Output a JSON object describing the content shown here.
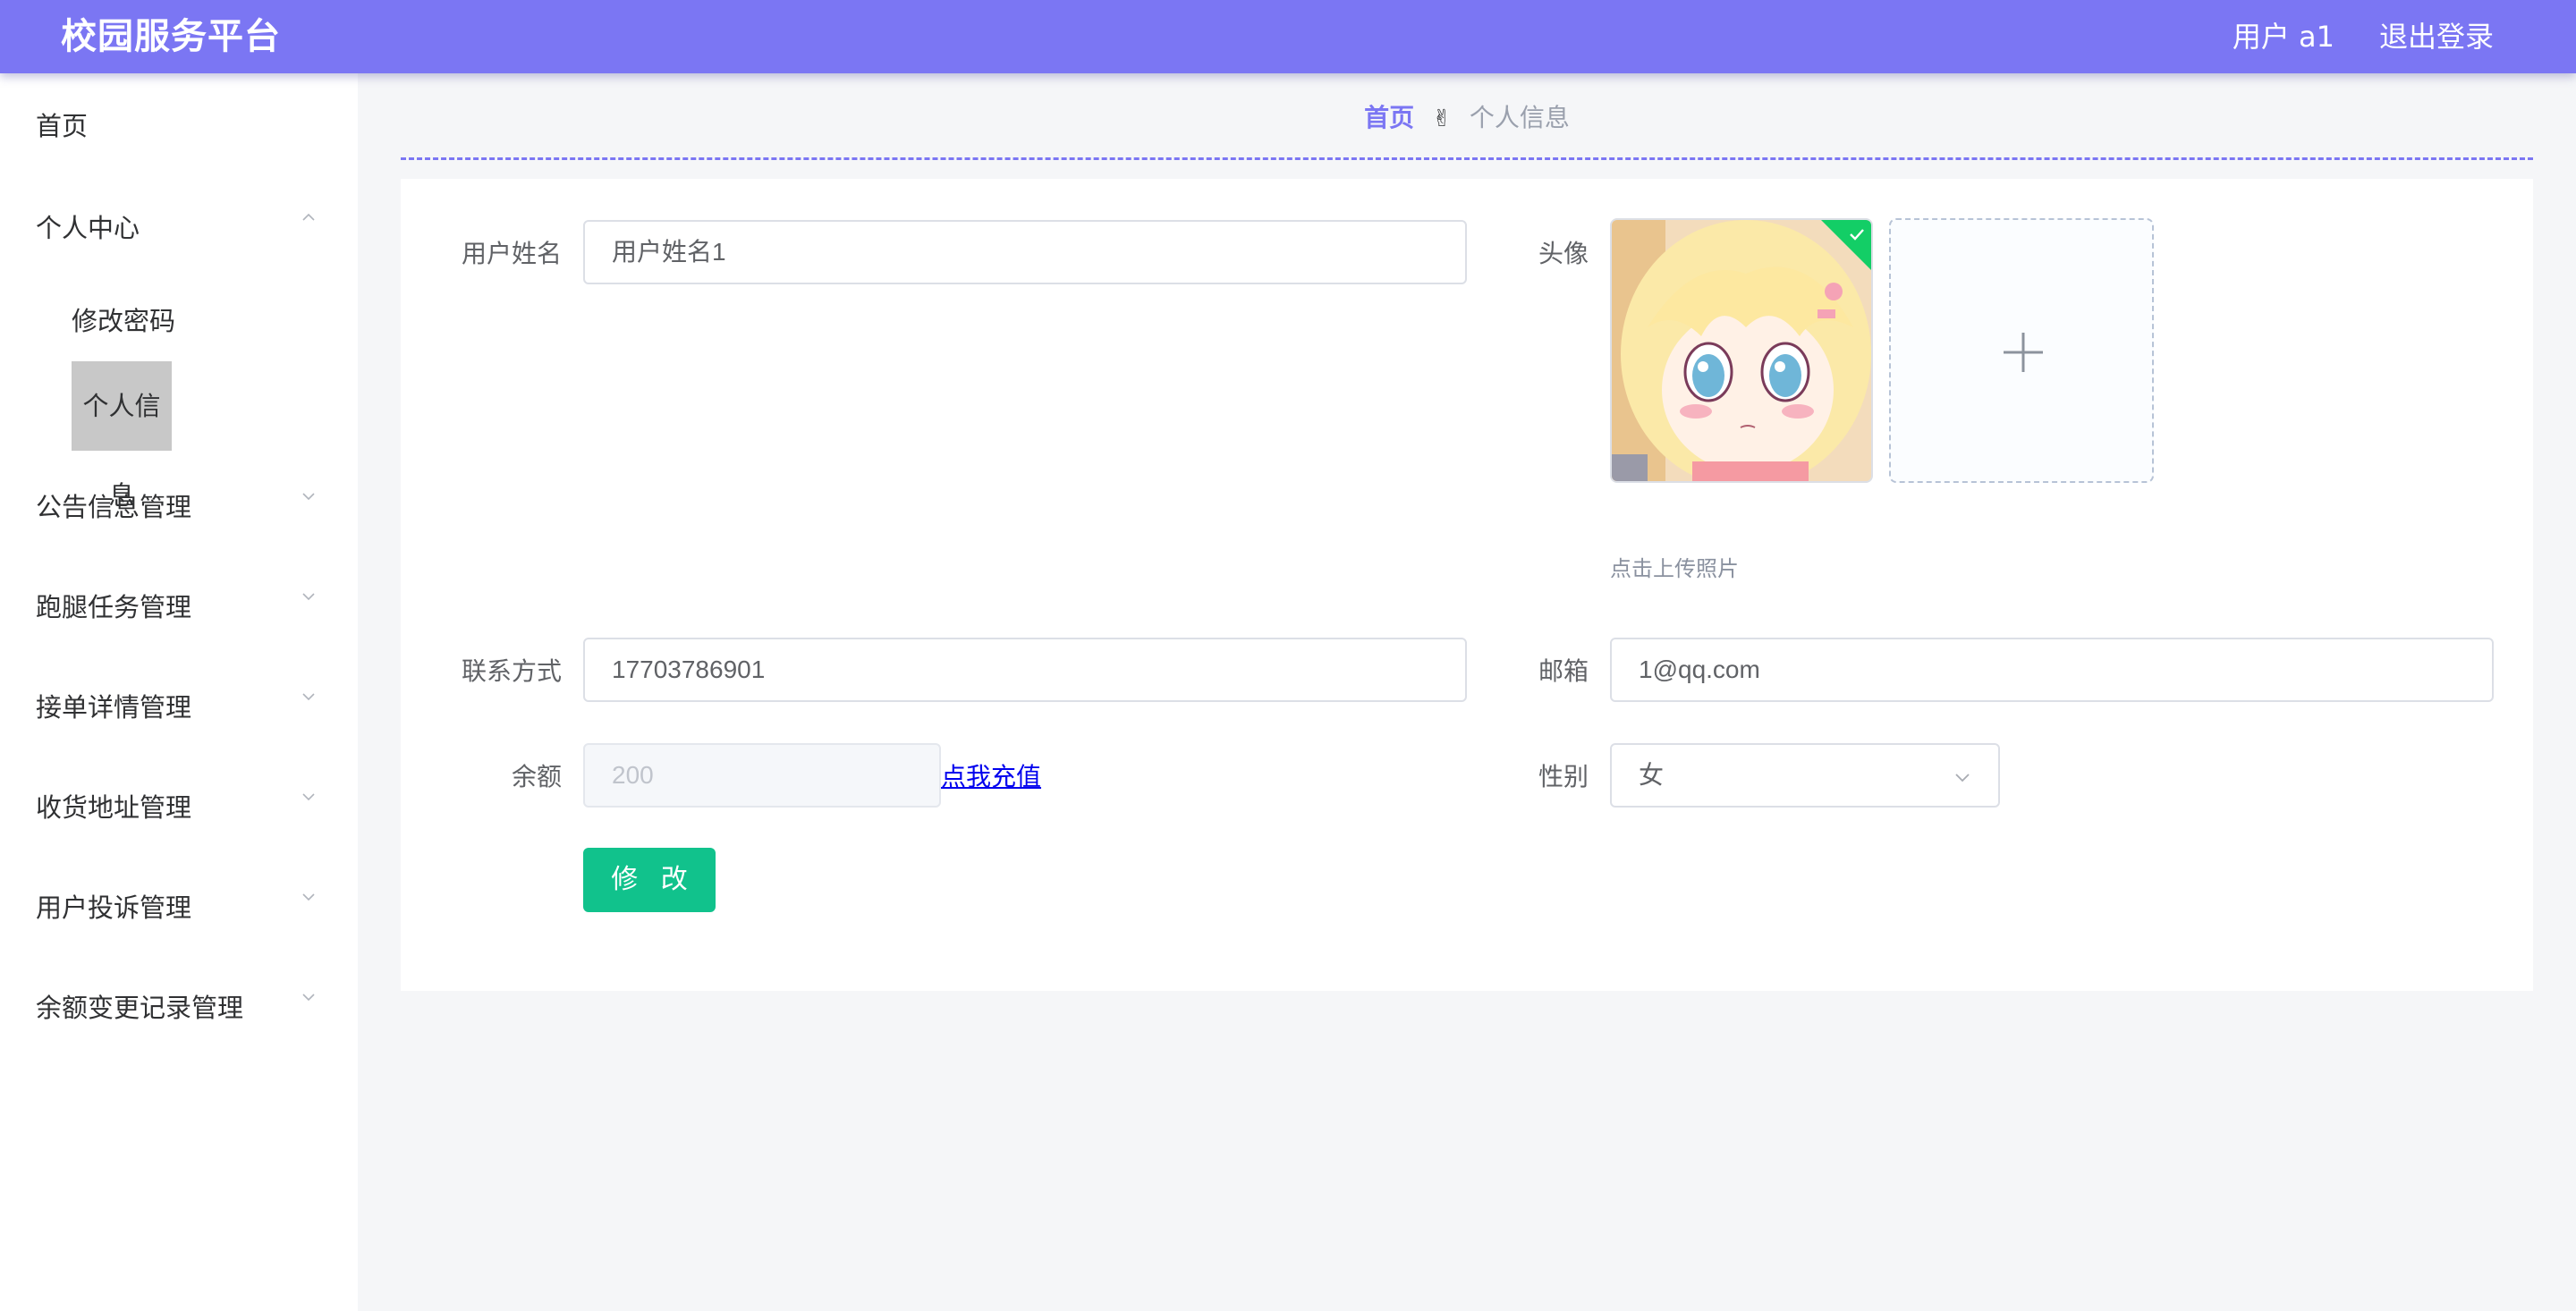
{
  "header": {
    "brand": "校园服务平台",
    "user": "用户 a1",
    "logout": "退出登录"
  },
  "sidebar": {
    "items": [
      {
        "label": "首页"
      },
      {
        "label": "个人中心",
        "expanded": true,
        "children": [
          {
            "label": "修改密码"
          },
          {
            "label": "个人信息",
            "active": true
          }
        ]
      },
      {
        "label": "公告信息管理"
      },
      {
        "label": "跑腿任务管理"
      },
      {
        "label": "接单详情管理"
      },
      {
        "label": "收货地址管理"
      },
      {
        "label": "用户投诉管理"
      },
      {
        "label": "余额变更记录管理"
      }
    ]
  },
  "breadcrumb": {
    "home": "首页",
    "separator": "✌",
    "current": "个人信息"
  },
  "form": {
    "username": {
      "label": "用户姓名",
      "value": "用户姓名1"
    },
    "avatar": {
      "label": "头像",
      "tip": "点击上传照片"
    },
    "phone": {
      "label": "联系方式",
      "value": "17703786901"
    },
    "email": {
      "label": "邮箱",
      "value": "1@qq.com"
    },
    "balance": {
      "label": "余额",
      "value": "200",
      "recharge": "点我充值"
    },
    "gender": {
      "label": "性别",
      "value": "女"
    },
    "submit": "修 改"
  },
  "colors": {
    "accent": "#7b76f3",
    "button": "#11c28c",
    "success": "#13ce66"
  },
  "icons": [
    "chevron-up-icon",
    "chevron-down-icon",
    "check-icon",
    "plus-icon"
  ]
}
